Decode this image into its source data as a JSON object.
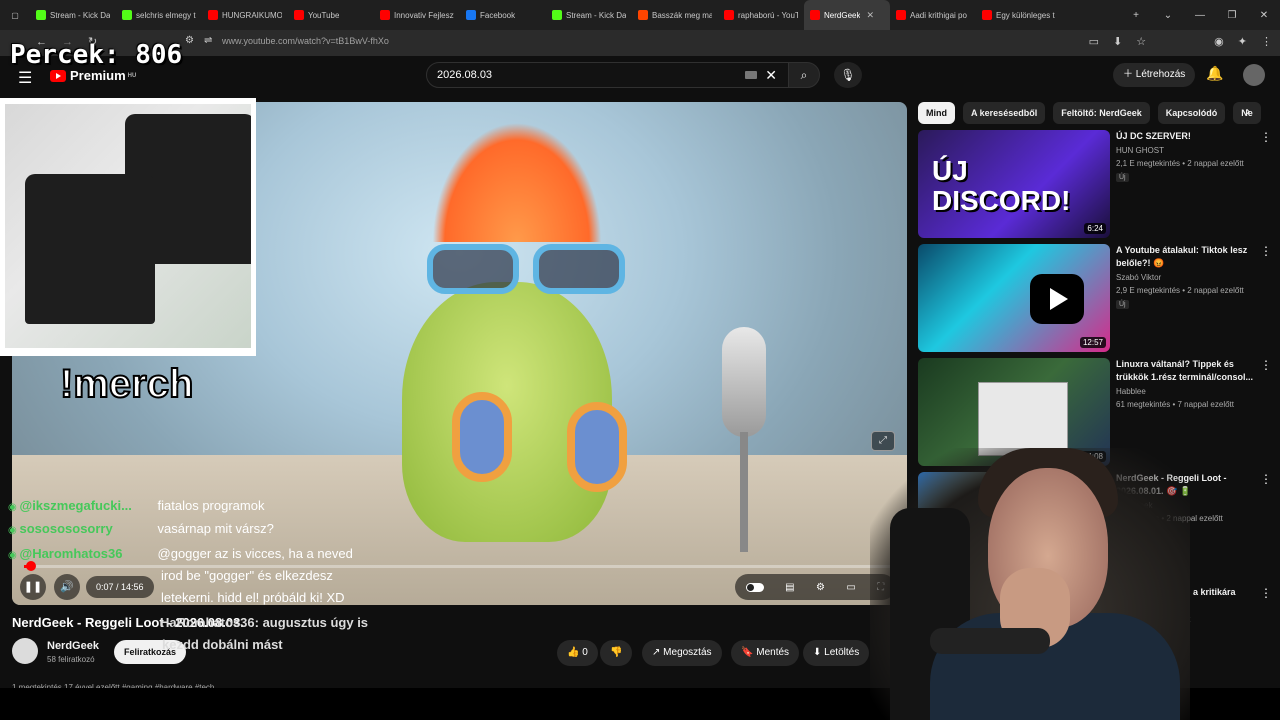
{
  "browser": {
    "tabs": [
      {
        "label": "Stream - Kick Das",
        "color": "#53fc18"
      },
      {
        "label": "selchris elmegy t",
        "color": "#53fc18"
      },
      {
        "label": "HUNGRAIKUMO",
        "color": "#ff0000"
      },
      {
        "label": "YouTube",
        "color": "#ff0000"
      },
      {
        "label": "Innovativ Fejleszt",
        "color": "#ff0000"
      },
      {
        "label": "Facebook",
        "color": "#1877f2"
      },
      {
        "label": "Stream - Kick Das",
        "color": "#53fc18"
      },
      {
        "label": "Basszák meg ma",
        "color": "#ff4500"
      },
      {
        "label": "raphaború - YouT",
        "color": "#ff0000"
      },
      {
        "label": "NerdGeek",
        "color": "#ff0000"
      },
      {
        "label": "Aadi krithigai po",
        "color": "#ff0000"
      },
      {
        "label": "Egy különleges t",
        "color": "#ff0000"
      }
    ],
    "active_tab": 9,
    "url": "www.youtube.com/watch?v=tB1BwV-fhXo"
  },
  "overlay": {
    "counter": "Percek: 806",
    "merch_text": "!merch"
  },
  "header": {
    "logo": "Premium",
    "logo_region": "HU",
    "search_value": "2026.08.03",
    "create_label": "Létrehozás"
  },
  "player": {
    "time": "0:07 / 14:56",
    "progress_fraction": 0.008
  },
  "chat": [
    {
      "user": "@ikszmegafucki...",
      "msg": "fiatalos programok",
      "color": "#46c85a"
    },
    {
      "user": "sososososorry",
      "msg": "vasárnap mit vársz?",
      "color": "#46c85a"
    },
    {
      "user": "@Haromhatos36",
      "msg": "@gogger az is vicces, ha a neved",
      "color": "#46c85a"
    },
    {
      "user": "",
      "msg": "irod be \"gogger\" és elkezdesz",
      "color": "#46c85a"
    },
    {
      "user": "",
      "msg": "letekerni. hidd el! próbáld ki! XD",
      "color": "#46c85a"
    }
  ],
  "video": {
    "title": "NerdGeek - Reggeli Loot - 2026.08.03.",
    "title_overlay": "HaRomhatos36: augusztus úgy is",
    "title_overlay2": "kezdd dobálni mást",
    "channel": "NerdGeek",
    "subs": "58 feliratkozó",
    "subscribe_label": "Feliratkozás",
    "likes": "0",
    "share_label": "Megosztás",
    "save_label": "Mentés",
    "download_label": "Letöltés",
    "meta": "1 megtekintés  17 évvel ezelőtt  #gaming #hardware #tech"
  },
  "chips": [
    "Mind",
    "A keresésedből",
    "Feltöltő: NerdGeek",
    "Kapcsolódó",
    "Ne"
  ],
  "recommendations": [
    {
      "title": "ÚJ DC SZERVER!",
      "channel": "HUN GHOST",
      "meta": "2,1 E megtekintés • 2 nappal ezelőtt",
      "badge": "Új",
      "duration": "6:24",
      "thumb_text": "ÚJ DISCORD!"
    },
    {
      "title": "A Youtube átalakul: Tiktok lesz belőle?! 😡",
      "channel": "Szabó Viktor",
      "meta": "2,9 E megtekintés • 2 nappal ezelőtt",
      "badge": "Új",
      "duration": "12:57",
      "thumb_text": ""
    },
    {
      "title": "Linuxra váltanál? Tippek és trükkök 1.rész terminál/consol...",
      "channel": "Habblee",
      "meta": "61 megtekintés • 7 nappal ezelőtt",
      "badge": "",
      "duration": "14:08",
      "thumb_text": ""
    },
    {
      "title": "NerdGeek - Reggeli Loot - 2026.08.01. 🎯 🔋",
      "channel": "NerdGeek",
      "meta": "megtekintés • 2 nappal ezelőtt",
      "badge": "",
      "duration": "",
      "thumb_text": ""
    },
    {
      "title": "obálok válaszolni a kritikára",
      "channel": "ativ Fejlesztő Csapat",
      "meta": "ntés • 1 évvel ezelőtt",
      "badge": "",
      "duration": "",
      "thumb_text": ""
    }
  ]
}
